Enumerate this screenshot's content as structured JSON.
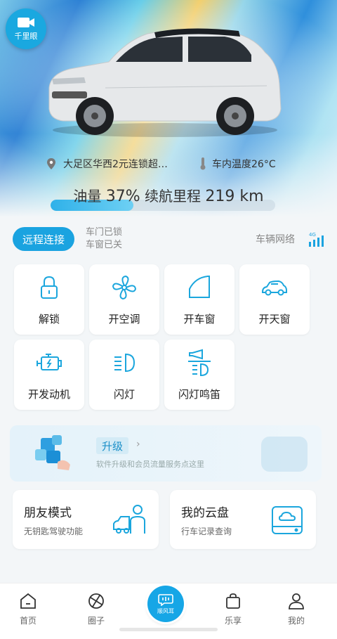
{
  "header": {
    "camera_label": "千里眼"
  },
  "location": {
    "address": "大足区华西2元连锁超…",
    "temperature": "车内温度26°C"
  },
  "fuel": {
    "label": "油量",
    "percent_text": "37%",
    "percent": 37,
    "range_label": "续航里程",
    "range_value": "219 km"
  },
  "status": {
    "remote_button": "远程连接",
    "door_status": "车门已锁",
    "window_status": "车窗已关",
    "network_label": "车辆网络",
    "network_type": "4G"
  },
  "controls": [
    {
      "label": "解锁",
      "icon": "unlock-icon"
    },
    {
      "label": "开空调",
      "icon": "fan-icon"
    },
    {
      "label": "开车窗",
      "icon": "car-window-icon"
    },
    {
      "label": "开天窗",
      "icon": "sunroof-icon"
    },
    {
      "label": "开发动机",
      "icon": "engine-icon"
    },
    {
      "label": "闪灯",
      "icon": "headlight-icon"
    },
    {
      "label": "闪灯鸣笛",
      "icon": "horn-light-icon"
    }
  ],
  "upgrade": {
    "title": "升级",
    "description": "软件升级和会员流量服务点这里"
  },
  "cards": {
    "friend_mode": {
      "title": "朋友模式",
      "subtitle": "无钥匙驾驶功能"
    },
    "cloud_disk": {
      "title": "我的云盘",
      "subtitle": "行车记录查询"
    }
  },
  "nav": {
    "home": "首页",
    "circle": "圈子",
    "center": "顺风耳",
    "enjoy": "乐享",
    "mine": "我的"
  },
  "colors": {
    "accent": "#1aa3e0",
    "icon": "#1ba6dd"
  }
}
